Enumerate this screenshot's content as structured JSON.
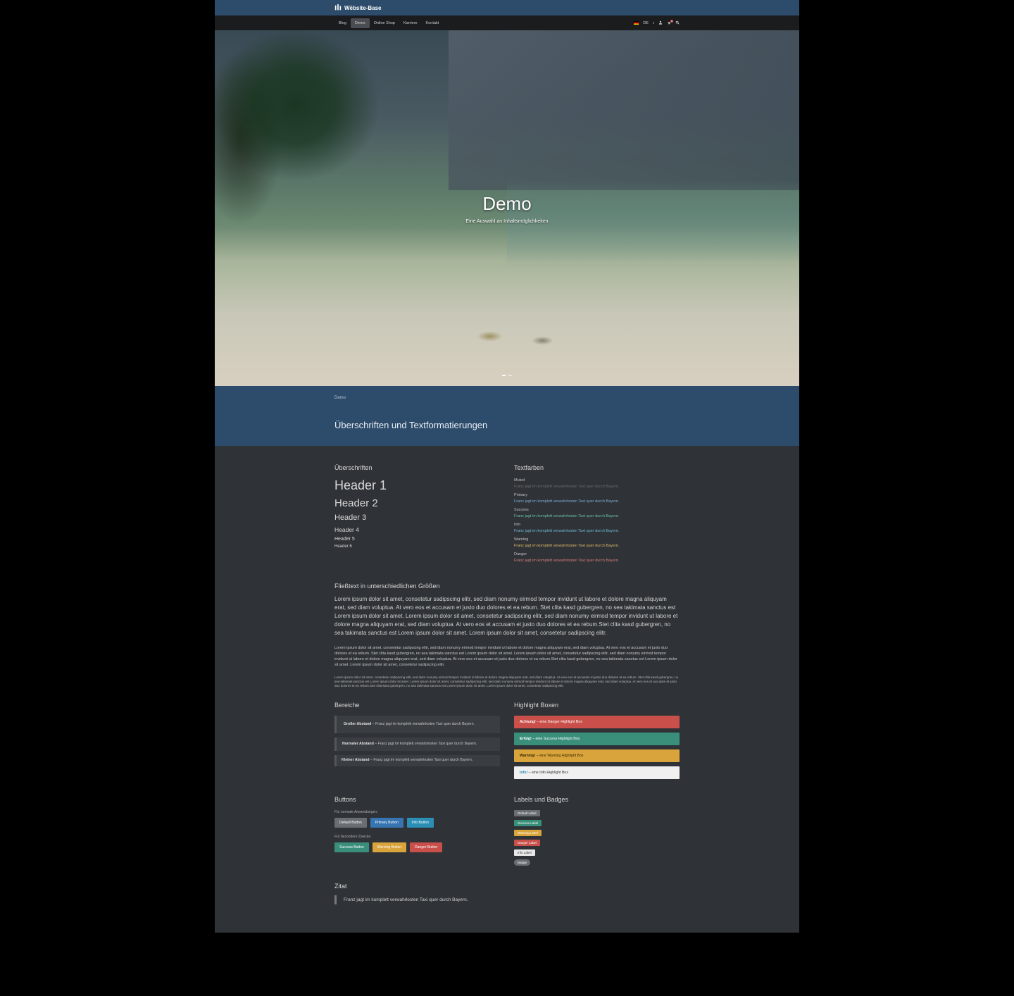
{
  "brand": "Wëbsite-Base",
  "nav": {
    "items": [
      "Blog",
      "Demo",
      "Online Shop",
      "Karriere",
      "Kontakt"
    ],
    "active_index": 1,
    "lang": "DE",
    "cart_count": "0"
  },
  "hero": {
    "title": "Demo",
    "subtitle": "Eine Auswahl an Inhaltsmöglichkeiten"
  },
  "breadcrumb": "Demo",
  "section_title": "Überschriften und Textformatierungen",
  "headings": {
    "title": "Überschriften",
    "h1": "Header 1",
    "h2": "Header 2",
    "h3": "Header 3",
    "h4": "Header 4",
    "h5": "Header 5",
    "h6": "Header 6"
  },
  "textcolors": {
    "title": "Textfarben",
    "sample": "Franz jagt im komplett verwahrlosten Taxi quer durch Bayern.",
    "items": [
      {
        "label": "Muted",
        "class": "c-muted"
      },
      {
        "label": "Primary",
        "class": "c-primary"
      },
      {
        "label": "Success",
        "class": "c-success"
      },
      {
        "label": "Info",
        "class": "c-info"
      },
      {
        "label": "Warning",
        "class": "c-warning"
      },
      {
        "label": "Danger",
        "class": "c-danger"
      }
    ]
  },
  "flowtext": {
    "title": "Fließtext in unterschiedlichen Größen",
    "large": "Lorem ipsum dolor sit amet, consetetur sadipscing elitr, sed diam nonumy eirmod tempor invidunt ut labore et dolore magna aliquyam erat, sed diam voluptua. At vero eos et accusam et justo duo dolores et ea rebum. Stet clita kasd gubergren, no sea takimata sanctus est Lorem ipsum dolor sit amet. Lorem ipsum dolor sit amet, consetetur sadipscing elitr, sed diam nonumy eirmod tempor invidunt ut labore et dolore magna aliquyam erat, sed diam voluptua. At vero eos et accusam et justo duo dolores et ea rebum.Stet clita kasd gubergren, no sea takimata sanctus est Lorem ipsum dolor sit amet. Lorem ipsum dolor sit amet, consetetur sadipscing elitr.",
    "medium": "Lorem ipsum dolor sit amet, consetetur sadipscing elitr, sed diam nonumy eirmod tempor invidunt ut labore et dolore magna aliquyam erat, sed diam voluptua. At vero eos et accusam et justo duo dolores et ea rebum. Stet clita kasd gubergren, no sea takimata sanctus est Lorem ipsum dolor sit amet. Lorem ipsum dolor sit amet, consetetur sadipscing elitr, sed diam nonumy eirmod tempor invidunt ut labore et dolore magna aliquyam erat, sed diam voluptua. At vero eos et accusam et justo duo dolores et ea rebum.Stet clita kasd gubergren, no sea takimata sanctus est Lorem ipsum dolor sit amet. Lorem ipsum dolor sit amet, consetetur sadipscing elitr.",
    "small": "Lorem ipsum dolor sit amet, consetetur sadipscing elitr, sed diam nonumy eirmod tempor invidunt ut labore et dolore magna aliquyam erat, sed diam voluptua. At vero eos et accusam et justo duo dolores et ea rebum. Stet clita kasd gubergren, no sea takimata sanctus est Lorem ipsum dolor sit amet. Lorem ipsum dolor sit amet, consetetur sadipscing elitr, sed diam nonumy eirmod tempor invidunt ut labore et dolore magna aliquyam erat, sed diam voluptua. At vero eos et accusam et justo duo dolores et ea rebum.Stet clita kasd gubergren, no sea takimata sanctus est Lorem ipsum dolor sit amet. Lorem ipsum dolor sit amet, consetetur sadipscing elitr."
  },
  "bereiche": {
    "title": "Bereiche",
    "items": [
      {
        "strong": "Großer Abstand",
        "text": " – Franz jagt im komplett verwahrlosten Taxi quer durch Bayern."
      },
      {
        "strong": "Normaler Abstand",
        "text": " – Franz jagt im komplett verwahrlosten Taxi quer durch Bayern."
      },
      {
        "strong": "Kleiner Abstand",
        "text": " – Franz jagt im komplett verwahrlosten Taxi quer durch Bayern."
      }
    ]
  },
  "highlight": {
    "title": "Highlight Boxen",
    "items": [
      {
        "class": "al-danger",
        "strong": "Achtung!",
        "text": " – eine Danger Highlight Box"
      },
      {
        "class": "al-success",
        "strong": "Erfolg!",
        "text": " – eine Success Highlight Box"
      },
      {
        "class": "al-warning",
        "strong": "Warning!",
        "text": " – eine Warning Highlight Box"
      },
      {
        "class": "al-info",
        "strong": "Info!",
        "text": " – eine Info Highlight Box"
      }
    ]
  },
  "buttons": {
    "title": "Buttons",
    "normal_label": "Für normale Anwendungen:",
    "normal": [
      {
        "class": "def",
        "text": "Default Button"
      },
      {
        "class": "pri",
        "text": "Primary Button"
      },
      {
        "class": "inf",
        "text": "Info Button"
      }
    ],
    "special_label": "Für besondere Zwecke:",
    "special": [
      {
        "class": "suc",
        "text": "Success Button"
      },
      {
        "class": "war",
        "text": "Warning Button"
      },
      {
        "class": "dan",
        "text": "Danger Button"
      }
    ]
  },
  "labels": {
    "title": "Labels und Badges",
    "items": [
      {
        "class": "def",
        "text": "Default Label"
      },
      {
        "class": "suc",
        "text": "Success Label"
      },
      {
        "class": "war",
        "text": "Warning Label"
      },
      {
        "class": "dan",
        "text": "Danger Label"
      },
      {
        "class": "inf",
        "text": "Info Label"
      },
      {
        "class": "bad",
        "text": "Badge"
      }
    ]
  },
  "zitat": {
    "title": "Zitat",
    "text": "Franz jagt im komplett verwahrlosten Taxi quer durch Bayern."
  }
}
